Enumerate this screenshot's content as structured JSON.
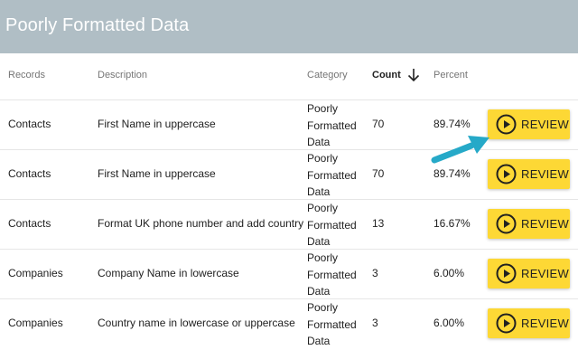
{
  "header": {
    "title": "Poorly Formatted Data"
  },
  "table": {
    "columns": {
      "records": "Records",
      "description": "Description",
      "category": "Category",
      "count": "Count",
      "percent": "Percent"
    },
    "sort_icon": "arrow-down-icon",
    "rows": [
      {
        "record": "Contacts",
        "description": "First Name in uppercase",
        "category": [
          "Poorly",
          "Formatted",
          "Data"
        ],
        "count": "70",
        "percent": "89.74%",
        "action": "REVIEW"
      },
      {
        "record": "Contacts",
        "description": "First Name in uppercase",
        "category": [
          "Poorly",
          "Formatted",
          "Data"
        ],
        "count": "70",
        "percent": "89.74%",
        "action": "REVIEW"
      },
      {
        "record": "Contacts",
        "description": "Format UK phone number and add country",
        "category": [
          "Poorly",
          "Formatted",
          "Data"
        ],
        "count": "13",
        "percent": "16.67%",
        "action": "REVIEW"
      },
      {
        "record": "Companies",
        "description": "Company Name in lowercase",
        "category": [
          "Poorly",
          "Formatted",
          "Data"
        ],
        "count": "3",
        "percent": "6.00%",
        "action": "REVIEW"
      },
      {
        "record": "Companies",
        "description": "Country name in lowercase or uppercase",
        "category": [
          "Poorly",
          "Formatted",
          "Data"
        ],
        "count": "3",
        "percent": "6.00%",
        "action": "REVIEW"
      }
    ]
  },
  "colors": {
    "header_bg": "#b0bec5",
    "button_bg": "#fdd835",
    "pointer_arrow": "#26a9c8"
  },
  "icons": {
    "play": "play-circle-icon",
    "pointer": "pointer-arrow-icon"
  }
}
